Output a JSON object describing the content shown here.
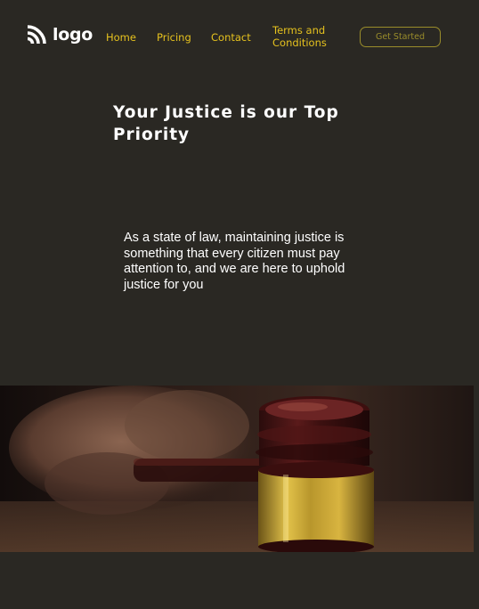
{
  "nav": {
    "logo_text": "logo",
    "links": {
      "home": "Home",
      "pricing": "Pricing",
      "contact": "Contact",
      "terms": "Terms and Conditions"
    },
    "cta_label": "Get Started"
  },
  "hero": {
    "title": "Your Justice is our Top Priority",
    "description": "As a state of law, maintaining justice is something that every citizen must pay attention to, and we are here to uphold justice for you"
  },
  "colors": {
    "background": "#2a2823",
    "nav_link": "#e6c21e",
    "cta": "#9a8d2b",
    "text": "#ffffff"
  },
  "icons": {
    "logo": "wifi-arcs-icon"
  }
}
